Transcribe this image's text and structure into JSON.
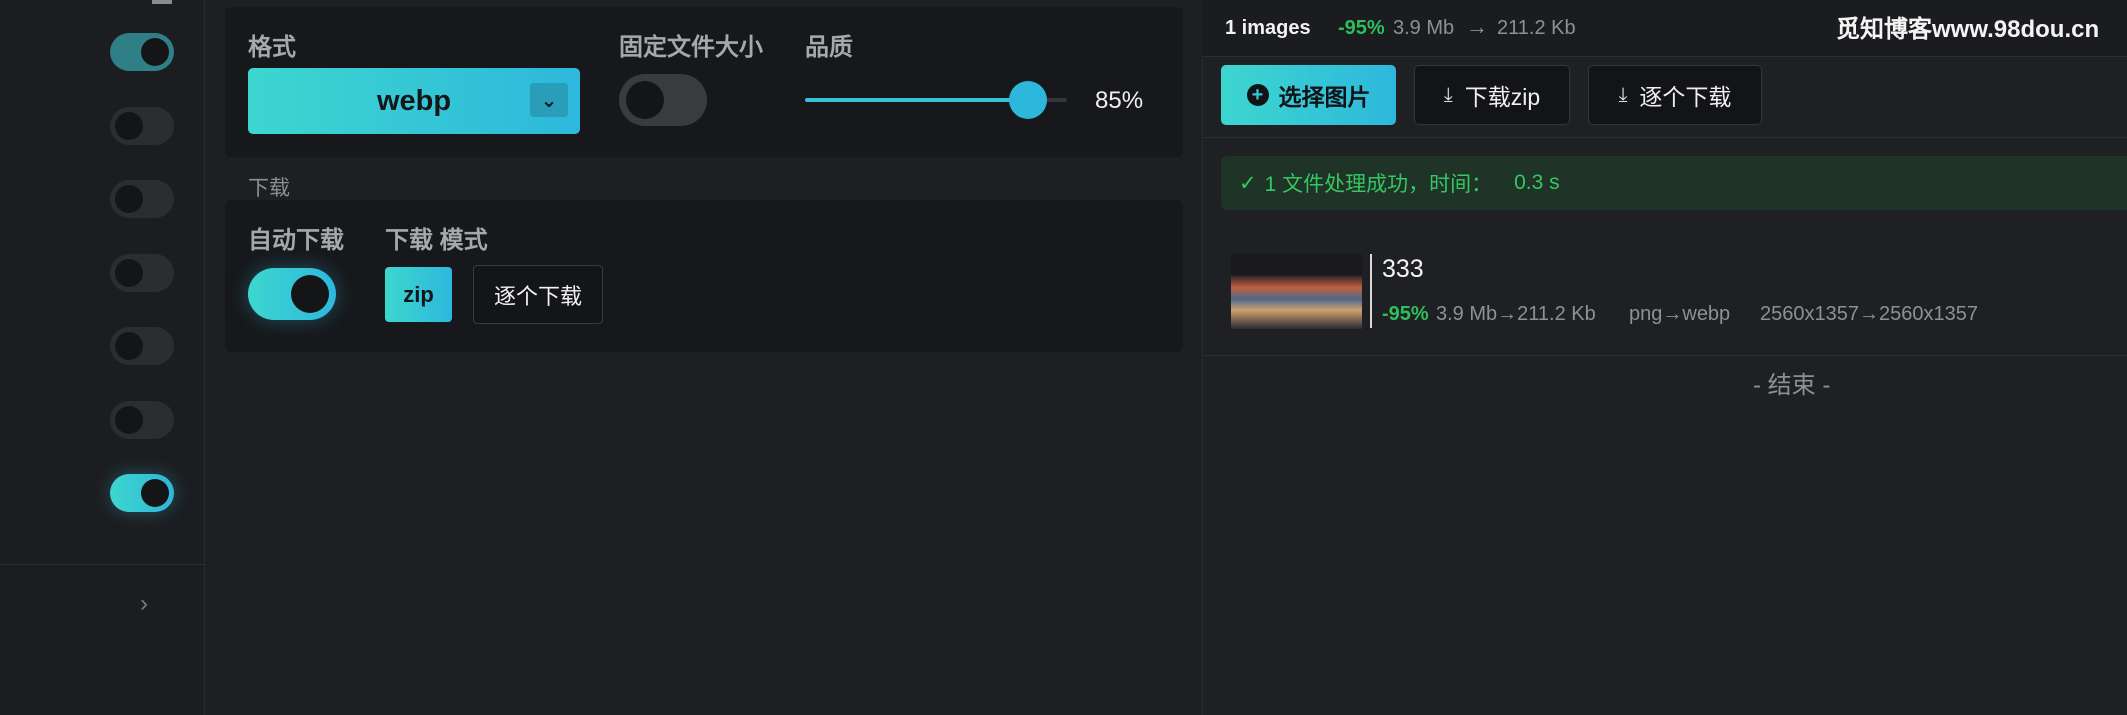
{
  "sidebar": {
    "toggles": [
      "on-dim",
      "off",
      "off",
      "off",
      "off",
      "off",
      "on"
    ],
    "chevron": "›"
  },
  "format_panel": {
    "format_label": "格式",
    "format_value": "webp",
    "fixed_size_label": "固定文件大小",
    "fixed_size_on": false,
    "quality_label": "品质",
    "quality_value": "85%",
    "quality_fraction": 0.85
  },
  "download_panel": {
    "section_label": "下载",
    "auto_label": "自动下载",
    "auto_on": true,
    "mode_label": "下载 模式",
    "mode_zip": "zip",
    "mode_each": "逐个下载"
  },
  "summary": {
    "count": "1 images",
    "pct": "-95%",
    "from": "3.9 Mb",
    "arrow": "→",
    "to": "211.2 Kb"
  },
  "watermark": "觅知博客www.98dou.cn",
  "toolbar": {
    "select_label": "选择图片",
    "zip_label": "下载zip",
    "each_label": "逐个下载"
  },
  "status": {
    "check": "✓",
    "message": "1 文件处理成功，时间：",
    "time": "0.3 s"
  },
  "file": {
    "name": "333",
    "pct": "-95%",
    "size": "3.9 Mb→211.2 Kb",
    "fmt": "png→webp",
    "dims": "2560x1357→2560x1357"
  },
  "end_label": "- 结束 -",
  "colors": {
    "accent": "#2db8dc",
    "accent2": "#3dd6cf",
    "success": "#2dbe5d"
  }
}
